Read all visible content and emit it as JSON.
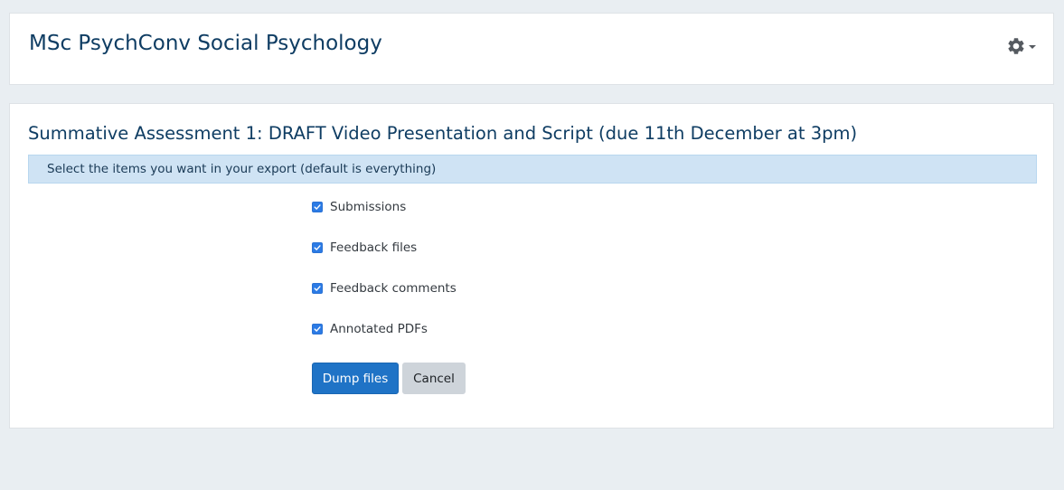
{
  "header": {
    "course_title": "MSc PsychConv Social Psychology",
    "settings_icon": "gear-icon"
  },
  "main": {
    "assignment_title": "Summative Assessment 1: DRAFT Video Presentation and Script (due 11th December at 3pm)",
    "info_text": "Select the items you want in your export (default is everything)",
    "options": [
      {
        "label": "Submissions",
        "checked": true
      },
      {
        "label": "Feedback files",
        "checked": true
      },
      {
        "label": "Feedback comments",
        "checked": true
      },
      {
        "label": "Annotated PDFs",
        "checked": true
      }
    ],
    "buttons": {
      "primary_label": "Dump files",
      "secondary_label": "Cancel"
    }
  },
  "colors": {
    "accent": "#1f73c6",
    "checkbox": "#2c7be5",
    "title": "#0f3d63",
    "info_background": "#cfe3f4",
    "page_background": "#e9eef2"
  }
}
